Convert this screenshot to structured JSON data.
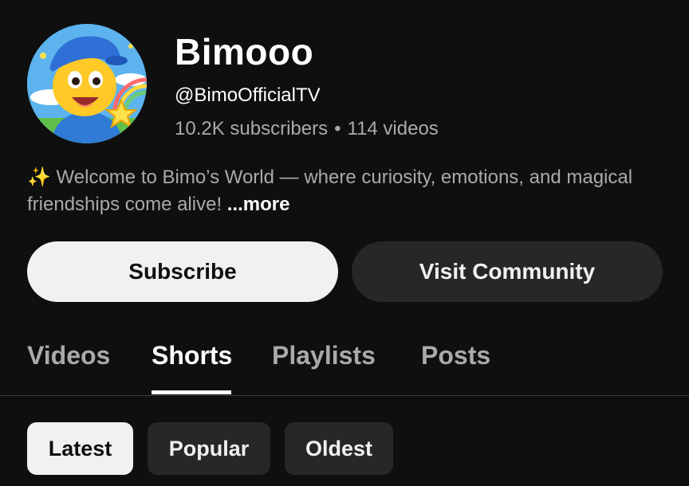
{
  "channel": {
    "name": "Bimooo",
    "handle": "@BimoOfficialTV",
    "subscribers": "10.2K subscribers",
    "separator": "•",
    "videos": "114 videos",
    "description_icon": "sparkles-icon",
    "description_emoji": "✨",
    "description": " Welcome to Bimo’s World — where curiosity, emotions, and magical friendships come alive! ",
    "more_label": "...more"
  },
  "actions": {
    "subscribe_label": "Subscribe",
    "community_label": "Visit Community"
  },
  "tabs": [
    {
      "label": "Videos",
      "active": false
    },
    {
      "label": "Shorts",
      "active": true
    },
    {
      "label": "Playlists",
      "active": false
    },
    {
      "label": "Posts",
      "active": false
    }
  ],
  "filters": [
    {
      "label": "Latest",
      "selected": true
    },
    {
      "label": "Popular",
      "selected": false
    },
    {
      "label": "Oldest",
      "selected": false
    }
  ],
  "colors": {
    "background": "#0f0f0f",
    "primary_button": "#f1f1f1",
    "secondary_button": "#272727",
    "muted_text": "#aaaaaa"
  }
}
